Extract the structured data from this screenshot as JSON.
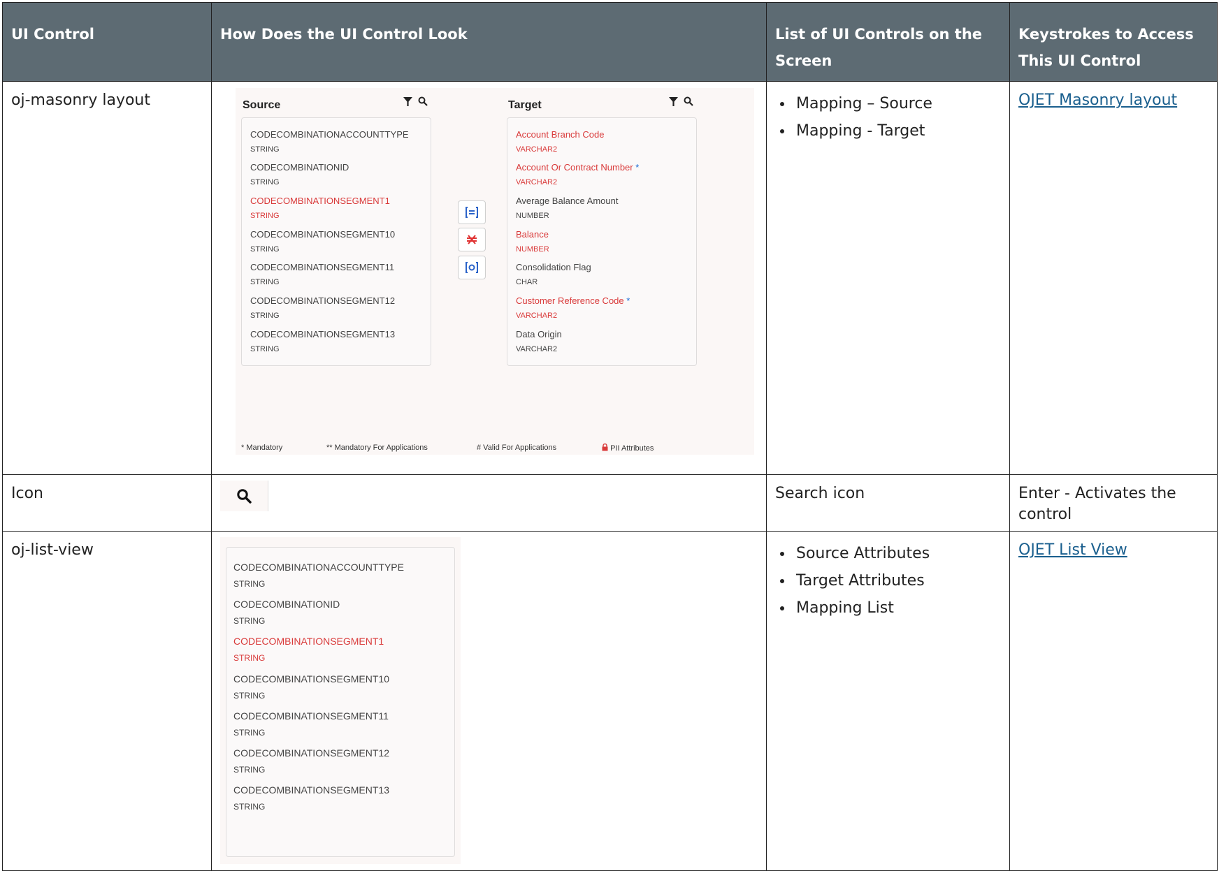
{
  "table": {
    "headers": [
      "UI Control",
      "How Does the UI Control Look",
      "List of UI Controls on the Screen",
      "Keystrokes to Access This UI Control"
    ],
    "rows": [
      {
        "control": "oj-masonry layout",
        "list": [
          "Mapping – Source",
          "Mapping - Target"
        ],
        "link": "OJET Masonry layout"
      },
      {
        "control": "Icon",
        "list_text": "Search icon",
        "keystroke": "Enter - Activates the control"
      },
      {
        "control": "oj-list-view",
        "list": [
          "Source Attributes",
          "Target Attributes",
          "Mapping List"
        ],
        "link": "OJET List View"
      }
    ]
  },
  "masonry_image": {
    "source_title": "Source",
    "target_title": "Target",
    "source_items": [
      {
        "name": "CODECOMBINATIONACCOUNTTYPE",
        "type": "STRING",
        "highlight": false
      },
      {
        "name": "CODECOMBINATIONID",
        "type": "STRING",
        "highlight": false
      },
      {
        "name": "CODECOMBINATIONSEGMENT1",
        "type": "STRING",
        "highlight": true
      },
      {
        "name": "CODECOMBINATIONSEGMENT10",
        "type": "STRING",
        "highlight": false
      },
      {
        "name": "CODECOMBINATIONSEGMENT11",
        "type": "STRING",
        "highlight": false
      },
      {
        "name": "CODECOMBINATIONSEGMENT12",
        "type": "STRING",
        "highlight": false
      },
      {
        "name": "CODECOMBINATIONSEGMENT13",
        "type": "STRING",
        "highlight": false
      }
    ],
    "target_items": [
      {
        "name": "Account Branch Code",
        "type": "VARCHAR2",
        "highlight": true,
        "mandatory": false
      },
      {
        "name": "Account Or Contract Number",
        "type": "VARCHAR2",
        "highlight": true,
        "mandatory": true
      },
      {
        "name": "Average Balance Amount",
        "type": "NUMBER",
        "highlight": false,
        "mandatory": false
      },
      {
        "name": "Balance",
        "type": "NUMBER",
        "highlight": true,
        "mandatory": false
      },
      {
        "name": "Consolidation Flag",
        "type": "CHAR",
        "highlight": false,
        "mandatory": false
      },
      {
        "name": "Customer Reference Code",
        "type": "VARCHAR2",
        "highlight": true,
        "mandatory": true
      },
      {
        "name": "Data Origin",
        "type": "VARCHAR2",
        "highlight": false,
        "mandatory": false
      }
    ],
    "legend": {
      "mandatory": "* Mandatory",
      "mandatory_apps": "** Mandatory For Applications",
      "valid_apps": "# Valid For Applications",
      "pii": "PII Attributes"
    },
    "colors": {
      "highlight": "#d93a3a",
      "star": "#1a6bd6",
      "header_bg": "#5d6b73"
    }
  },
  "list_view_image": {
    "items": [
      {
        "name": "CODECOMBINATIONACCOUNTTYPE",
        "type": "STRING",
        "highlight": false
      },
      {
        "name": "CODECOMBINATIONID",
        "type": "STRING",
        "highlight": false
      },
      {
        "name": "CODECOMBINATIONSEGMENT1",
        "type": "STRING",
        "highlight": true
      },
      {
        "name": "CODECOMBINATIONSEGMENT10",
        "type": "STRING",
        "highlight": false
      },
      {
        "name": "CODECOMBINATIONSEGMENT11",
        "type": "STRING",
        "highlight": false
      },
      {
        "name": "CODECOMBINATIONSEGMENT12",
        "type": "STRING",
        "highlight": false
      },
      {
        "name": "CODECOMBINATIONSEGMENT13",
        "type": "STRING",
        "highlight": false
      }
    ]
  }
}
